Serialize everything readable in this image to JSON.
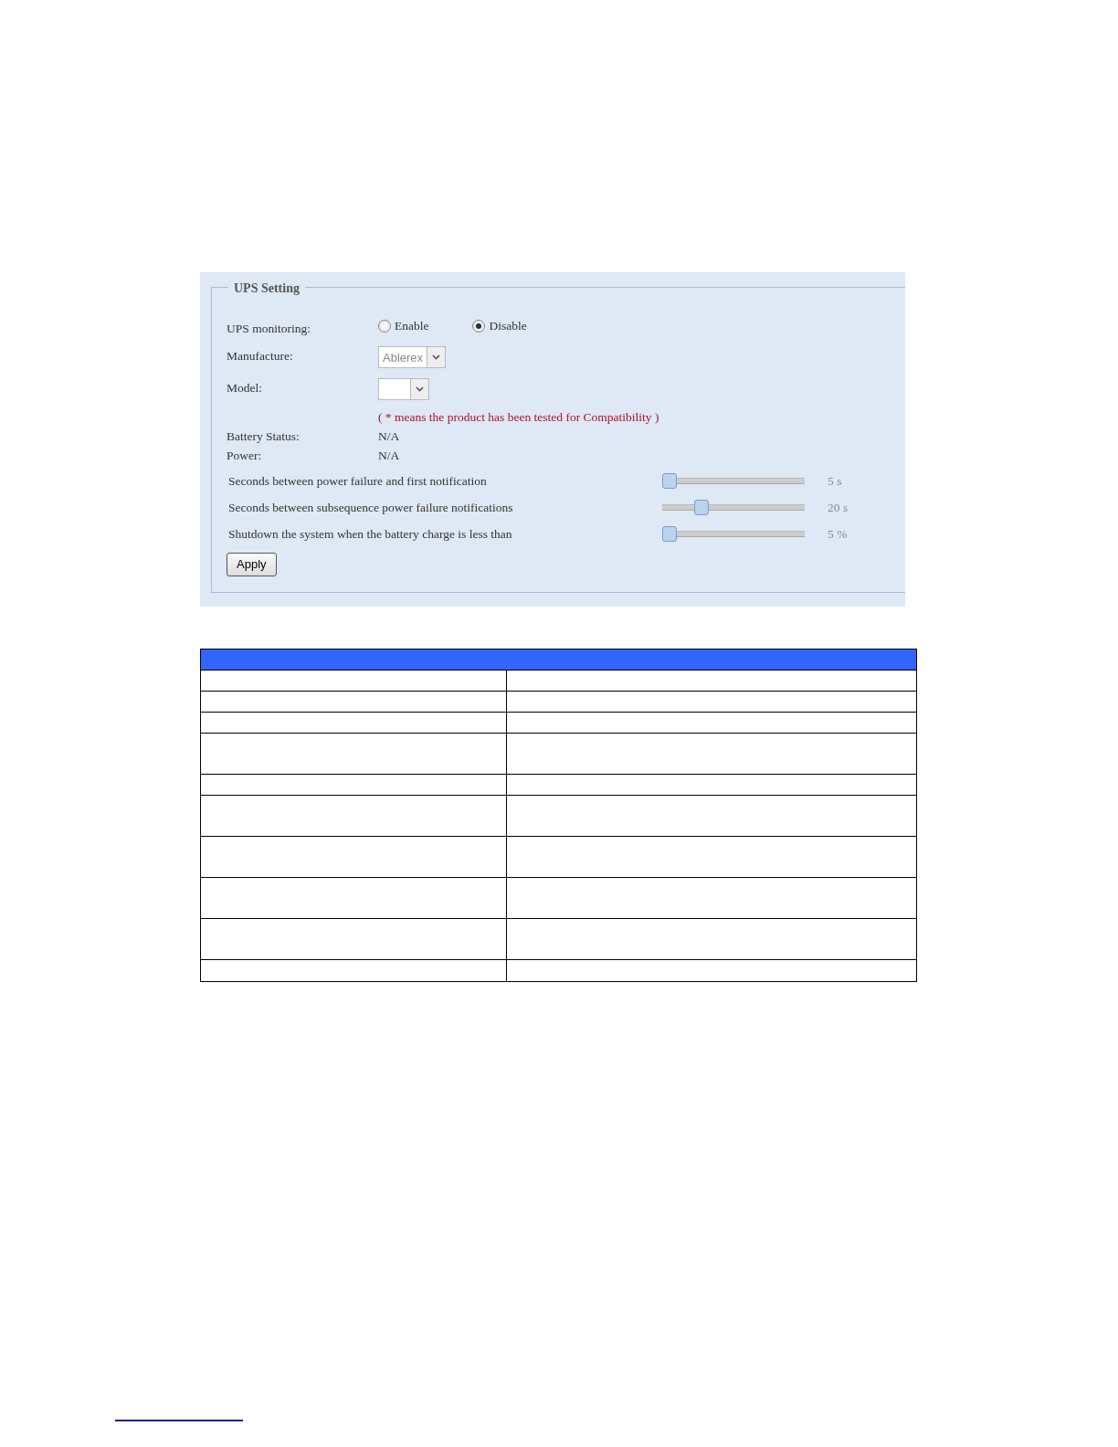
{
  "panel": {
    "title": "UPS Setting",
    "monitoring": {
      "label": "UPS monitoring:",
      "options": [
        {
          "label": "Enable",
          "selected": false
        },
        {
          "label": "Disable",
          "selected": true
        }
      ]
    },
    "manufacture": {
      "label": "Manufacture:",
      "value": "Ablerex",
      "disabled": true
    },
    "model": {
      "label": "Model:"
    },
    "note": "( * means the product has been tested for Compatibility )",
    "status": [
      {
        "label": "Battery Status:",
        "value": "N/A"
      },
      {
        "label": "Power:",
        "value": "N/A"
      }
    ],
    "sliders": [
      {
        "label": "Seconds between power failure and first notification",
        "level": 0,
        "reading": "5 s"
      },
      {
        "label": "Seconds between subsequence power failure notifications",
        "level": 0.25,
        "reading": "20 s"
      },
      {
        "label": "Shutdown the system when the battery charge is less than",
        "level": 0,
        "reading": "5 %"
      }
    ],
    "apply": "Apply"
  }
}
